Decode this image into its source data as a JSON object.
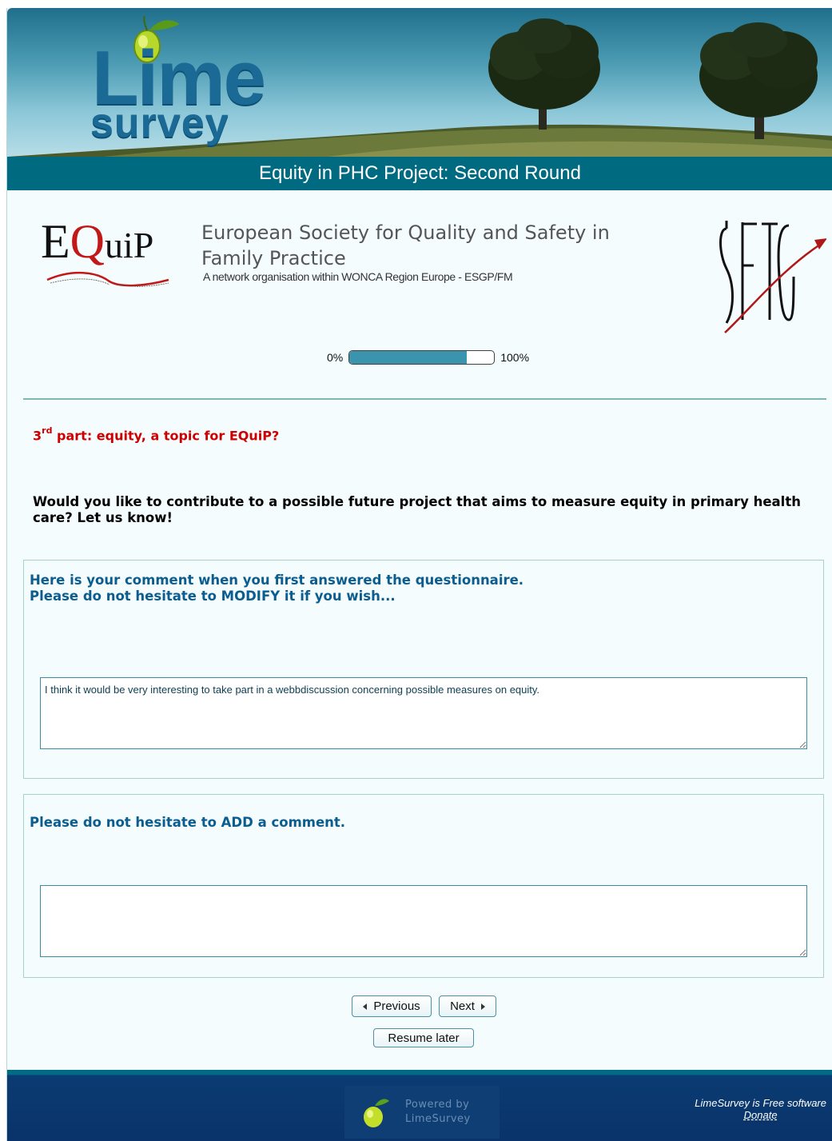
{
  "header": {
    "logo_line1": "Lime",
    "logo_line2": "survey",
    "survey_title": "Equity in PHC Project: Second Round"
  },
  "description": {
    "equip_logo": {
      "e": "E",
      "q": "Q",
      "uip": "uiP"
    },
    "society_name": "European Society for Quality and Safety in Family Practice",
    "society_subtitle": "A network organisation within WONCA Region Europe - ESGP/FM",
    "sftg_logo": "SFTG"
  },
  "progress": {
    "start_label": "0%",
    "end_label": "100%",
    "fraction": 0.81
  },
  "group": {
    "title_num": "3",
    "title_sup": "rd",
    "title_rest": " part: equity, a topic for EQuiP?",
    "description": "Would you like to contribute to a possible future project that aims to measure equity in primary health care? Let us know!"
  },
  "questions": [
    {
      "text": "Here is your comment when you first answered the questionnaire.\nPlease do not hesitate to MODIFY it if you wish...",
      "answer": "I think it would be very interesting to take part in a webbdiscussion concerning possible measures on equity."
    },
    {
      "text": "Please do not hesitate to ADD a comment.",
      "answer": ""
    }
  ],
  "navigation": {
    "previous_label": "Previous",
    "next_label": "Next",
    "resume_label": "Resume later"
  },
  "footer": {
    "powered_line1": "Powered by",
    "powered_line2": "LimeSurvey",
    "free_software": "LimeSurvey is Free software",
    "donate": "Donate"
  },
  "colors": {
    "title_bar": "#006a80",
    "question_text": "#0c5d8f",
    "group_title": "#cc0000",
    "progress_fill": "#3b94ad",
    "footer": "#09336a"
  }
}
